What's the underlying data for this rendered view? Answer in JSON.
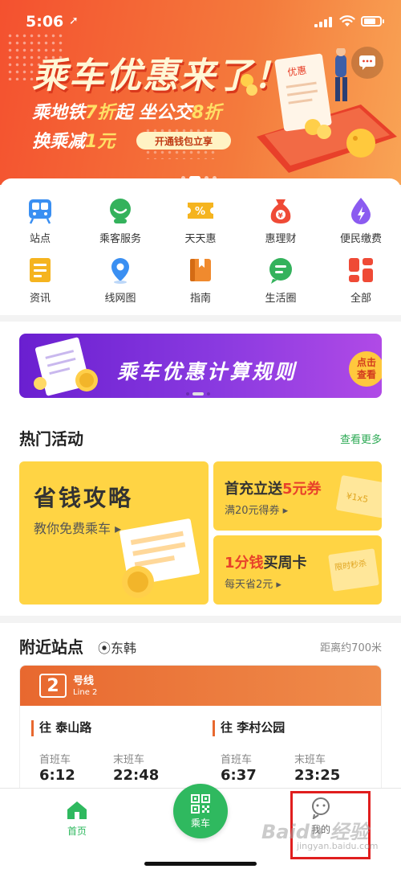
{
  "status_bar": {
    "time": "5:06",
    "location_arrow": "➚"
  },
  "hero": {
    "title": "乘车优惠来了！",
    "line1_a": "乘地铁",
    "line1_hl1": "7折",
    "line1_b": "起 坐公交",
    "line1_hl2": "8折",
    "line2_a": "换乘减",
    "line2_hl": "1元",
    "cta": "开通钱包立享",
    "tag": "优惠"
  },
  "menu": [
    {
      "label": "站点",
      "icon": "subway-station-icon",
      "color": "#3a8ff2"
    },
    {
      "label": "乘客服务",
      "icon": "customer-service-icon",
      "color": "#34b25c"
    },
    {
      "label": "天天惠",
      "icon": "coupon-icon",
      "color": "#f5b41f"
    },
    {
      "label": "惠理财",
      "icon": "money-bag-icon",
      "color": "#ef4a36"
    },
    {
      "label": "便民缴费",
      "icon": "lightning-drop-icon",
      "color": "#8b5bf0"
    },
    {
      "label": "资讯",
      "icon": "news-icon",
      "color": "#f5b41f"
    },
    {
      "label": "线网图",
      "icon": "map-pin-icon",
      "color": "#3a8ff2"
    },
    {
      "label": "指南",
      "icon": "guide-book-icon",
      "color": "#f08a2e"
    },
    {
      "label": "生活圈",
      "icon": "chat-bubble-icon",
      "color": "#34b25c"
    },
    {
      "label": "全部",
      "icon": "all-grid-icon",
      "color": "#ef4a36"
    }
  ],
  "promo": {
    "text": "乘车优惠计算规则",
    "badge_l1": "点击",
    "badge_l2": "查看"
  },
  "hot": {
    "title": "热门活动",
    "more": "查看更多",
    "big_t1": "省钱攻略",
    "big_t2": "教你免费乘车 ▸",
    "card1_a": "首充立送",
    "card1_red": "5元券",
    "card1_t2": "满20元得券 ▸",
    "card2_a": "1分钱",
    "card2_b": "买周卡",
    "card2_t2": "每天省2元 ▸",
    "card1_deco": "¥1x5",
    "card2_deco": "限时秒杀"
  },
  "nearby": {
    "title": "附近站点",
    "location": "东韩",
    "distance": "距离约700米",
    "line_num": "2",
    "line_name": "号线",
    "line_en": "Line 2",
    "dirs": [
      {
        "name": "往 泰山路",
        "first_label": "首班车",
        "first": "6:12",
        "last_label": "末班车",
        "last": "22:48"
      },
      {
        "name": "往 李村公园",
        "first_label": "首班车",
        "first": "6:37",
        "last_label": "末班车",
        "last": "23:25"
      }
    ]
  },
  "tabbar": {
    "home": "首页",
    "ride": "乘车",
    "mine": "我的"
  },
  "watermark": {
    "main": "Baidu 经验",
    "sub": "jingyan.baidu.com"
  },
  "colors": {
    "green": "#2fb95f",
    "orange": "#f4512f",
    "highlight": "#e01e1e"
  }
}
